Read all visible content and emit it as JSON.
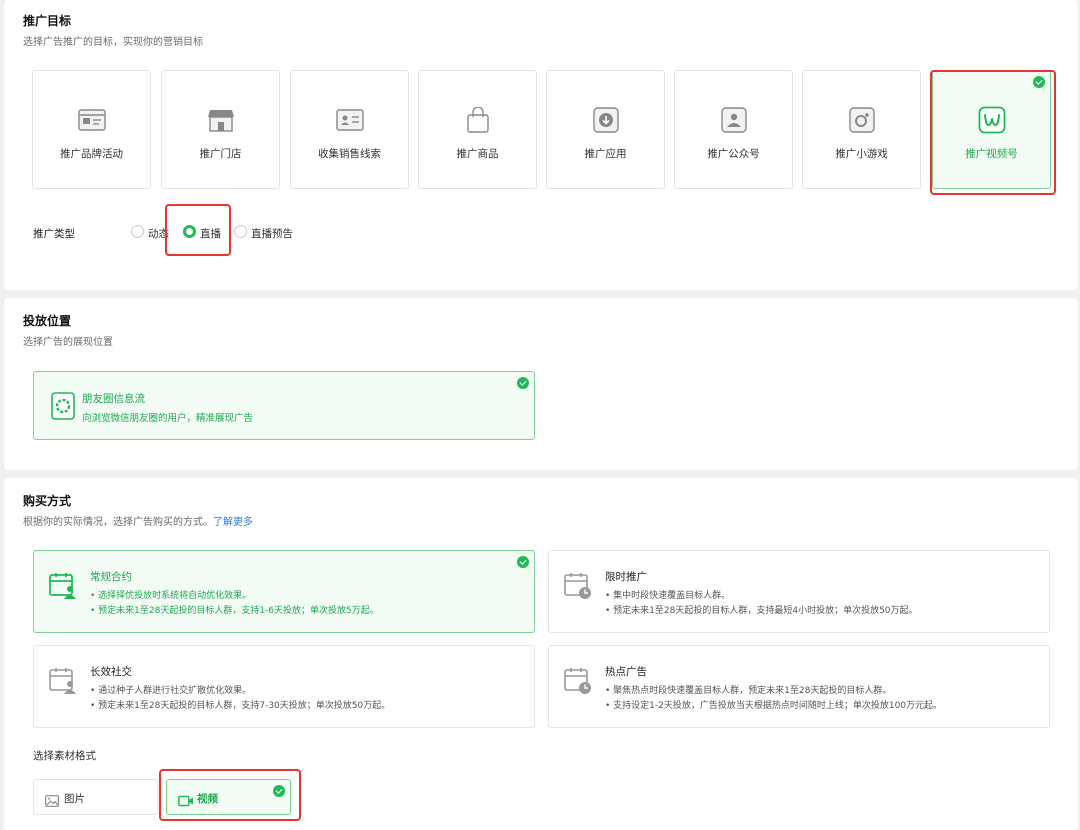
{
  "goal": {
    "title": "推广目标",
    "subtitle": "选择广告推广的目标，实现你的营销目标",
    "cards": [
      {
        "label": "推广品牌活动",
        "icon": "brand-activity-icon",
        "selected": false
      },
      {
        "label": "推广门店",
        "icon": "store-icon",
        "selected": false
      },
      {
        "label": "收集销售线索",
        "icon": "sales-lead-card-icon",
        "selected": false
      },
      {
        "label": "推广商品",
        "icon": "shopping-bag-icon",
        "selected": false
      },
      {
        "label": "推广应用",
        "icon": "app-download-icon",
        "selected": false
      },
      {
        "label": "推广公众号",
        "icon": "official-account-icon",
        "selected": false
      },
      {
        "label": "推广小游戏",
        "icon": "mini-game-icon",
        "selected": false
      },
      {
        "label": "推广视频号",
        "icon": "channels-icon",
        "selected": true
      }
    ],
    "promo_type": {
      "label": "推广类型",
      "options": [
        {
          "label": "动态",
          "selected": false
        },
        {
          "label": "直播",
          "selected": true
        },
        {
          "label": "直播预告",
          "selected": false
        }
      ]
    }
  },
  "placement": {
    "title": "投放位置",
    "subtitle": "选择广告的展现位置",
    "card": {
      "title": "朋友圈信息流",
      "desc": "向浏览微信朋友圈的用户，精准展现广告",
      "selected": true
    }
  },
  "purchase": {
    "title": "购买方式",
    "subtitle": "根据你的实际情况，选择广告购买的方式。",
    "learn_more": "了解更多",
    "cards": [
      {
        "title": "常规合约",
        "lines": [
          "• 选择择优投放时系统将自动优化效果。",
          "• 预定未来1至28天起投的目标人群，支持1-6天投放；单次投放5万起。"
        ],
        "selected": true
      },
      {
        "title": "限时推广",
        "lines": [
          "• 集中时段快速覆盖目标人群。",
          "• 预定未来1至28天起投的目标人群，支持最短4小时投放；单次投放50万起。"
        ],
        "selected": false
      },
      {
        "title": "长效社交",
        "lines": [
          "• 通过种子人群进行社交扩散优化效果。",
          "• 预定未来1至28天起投的目标人群，支持7-30天投放；单次投放50万起。"
        ],
        "selected": false
      },
      {
        "title": "热点广告",
        "lines": [
          "• 聚焦热点时段快速覆盖目标人群，预定未来1至28天起投的目标人群。",
          "• 支持设定1-2天投放，广告投放当天根据热点时间随时上线；单次投放100万元起。"
        ],
        "selected": false
      }
    ],
    "format": {
      "label": "选择素材格式",
      "options": [
        {
          "label": "图片",
          "selected": false
        },
        {
          "label": "视频",
          "selected": true
        }
      ]
    }
  },
  "colors": {
    "accent": "#1fba57",
    "highlight": "#e8352b",
    "link": "#2f7be0"
  }
}
